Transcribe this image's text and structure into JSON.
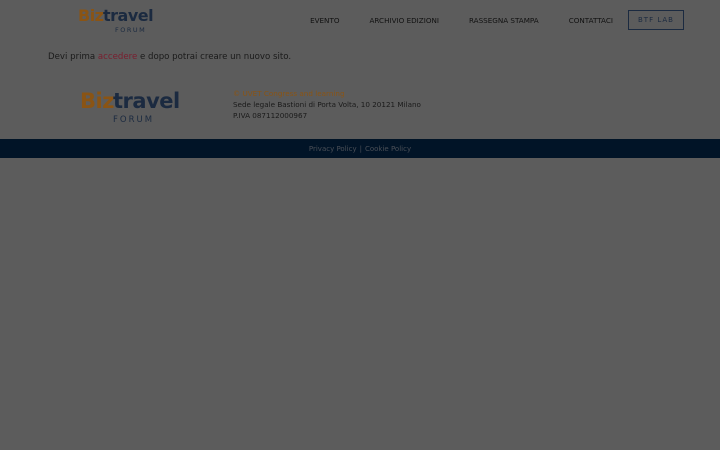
{
  "header": {
    "logo": {
      "biz": "Biz",
      "travel": "travel",
      "forum": "FORUM"
    },
    "nav": [
      {
        "label": "EVENTO"
      },
      {
        "label": "ARCHIVIO EDIZIONI"
      },
      {
        "label": "RASSEGNA STAMPA"
      },
      {
        "label": "CONTATTACI"
      }
    ],
    "lab_button": "BTF LAB"
  },
  "main": {
    "message_before": "Devi prima ",
    "login_link": "accedere",
    "message_after": " e dopo potrai creare un nuovo sito."
  },
  "footer": {
    "logo": {
      "biz": "Biz",
      "travel": "travel",
      "forum": "FORUM"
    },
    "copyright": "© UVET Congress and learning",
    "address": "Sede legale Bastioni di Porta Volta, 10 20121 Milano",
    "vat": "P.IVA 087112000967",
    "privacy": "Privacy Policy",
    "separator": "|",
    "cookie": "Cookie Policy"
  },
  "colors": {
    "overlay_background": "#5c5c5c",
    "brand_orange": "#8a5414",
    "brand_navy": "#1b2a40",
    "link": "#7a1d2e",
    "bottom_bar": "#011427"
  }
}
